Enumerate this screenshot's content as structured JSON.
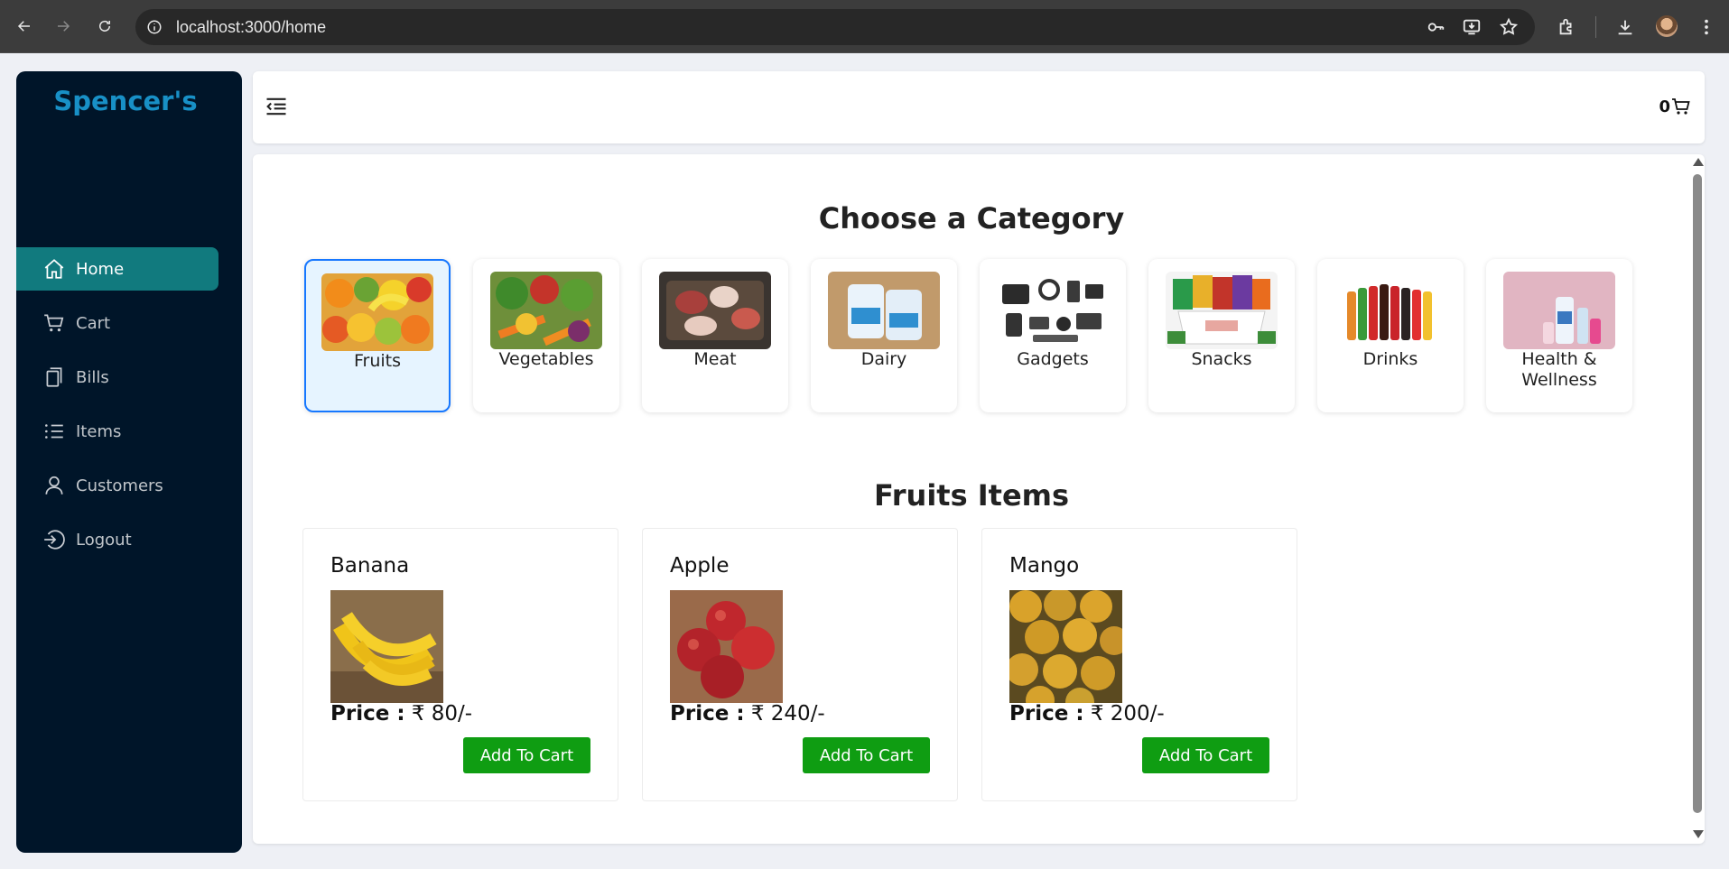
{
  "browser": {
    "url": "localhost:3000/home",
    "icons": [
      "back-icon",
      "forward-icon",
      "reload-icon",
      "site-info-icon",
      "password-key-icon",
      "install-app-icon",
      "bookmark-star-icon",
      "extensions-icon",
      "downloads-icon",
      "profile-avatar",
      "more-menu-icon"
    ]
  },
  "sidebar": {
    "brand": "Spencer's",
    "items": [
      {
        "label": "Home",
        "icon": "home-icon",
        "active": true
      },
      {
        "label": "Cart",
        "icon": "cart-icon"
      },
      {
        "label": "Bills",
        "icon": "bills-icon"
      },
      {
        "label": "Items",
        "icon": "list-icon"
      },
      {
        "label": "Customers",
        "icon": "user-icon"
      },
      {
        "label": "Logout",
        "icon": "logout-icon"
      }
    ]
  },
  "header": {
    "cart_count": "0",
    "icons": [
      "menu-collapse-icon",
      "cart-icon"
    ]
  },
  "categories": {
    "title": "Choose a Category",
    "items": [
      {
        "label": "Fruits",
        "selected": true
      },
      {
        "label": "Vegetables"
      },
      {
        "label": "Meat"
      },
      {
        "label": "Dairy"
      },
      {
        "label": "Gadgets"
      },
      {
        "label": "Snacks"
      },
      {
        "label": "Drinks"
      },
      {
        "label": "Health & Wellness"
      }
    ]
  },
  "items_section": {
    "title": "Fruits Items",
    "price_label": "Price :",
    "button_label": "Add To Cart",
    "items": [
      {
        "name": "Banana",
        "price": "₹ 80/-"
      },
      {
        "name": "Apple",
        "price": "₹ 240/-"
      },
      {
        "name": "Mango",
        "price": "₹ 200/-"
      }
    ]
  },
  "colors": {
    "sidebar_bg": "#001529",
    "active_menu": "#117a7e",
    "brand": "#1890c6",
    "add_button": "#0f9d12",
    "selected_card_border": "#1677ff"
  }
}
